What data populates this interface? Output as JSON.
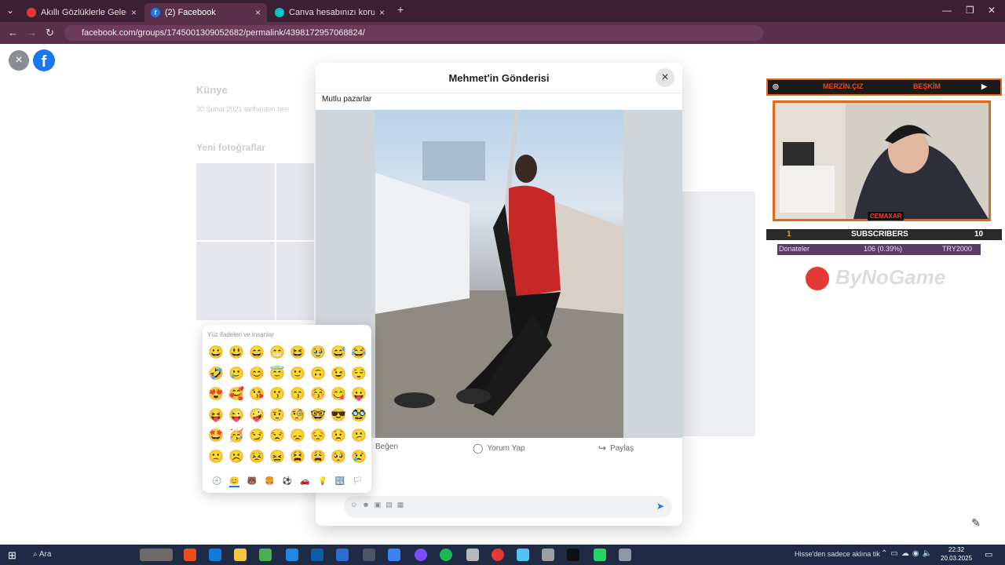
{
  "browser": {
    "tabs": [
      {
        "label": "Akıllı Gözlüklerle Geleceği",
        "favicon": "red-circle-icon",
        "color": "#e53935"
      },
      {
        "label": "(2) Facebook",
        "favicon": "facebook-icon",
        "color": "#1877f2"
      },
      {
        "label": "Canva hesabınızı koruyun",
        "favicon": "canva-icon",
        "color": "#00c4cc"
      }
    ],
    "new_tab": "+",
    "url": "facebook.com/groups/1745001309052682/permalink/4398172957068824/"
  },
  "page": {
    "close_button": "×",
    "logo": "f",
    "bg_heading": "Künye",
    "bg_info": "30 Şubat 2021 tarihinden beri",
    "bg_photos": "Yeni fotoğraflar"
  },
  "modal": {
    "title": "Mehmet'in Gönderisi",
    "close": "×",
    "post_text": "Mutlu pazarlar",
    "actions": {
      "like": "Beğen",
      "comment": "Yorum Yap",
      "share": "Paylaş"
    },
    "send_icon": "send-icon"
  },
  "emoji_picker": {
    "title": "Yüz ifadeleri ve insanlar",
    "emojis": [
      "😀",
      "😃",
      "😄",
      "😁",
      "😆",
      "🥹",
      "😅",
      "😂",
      "🤣",
      "🥲",
      "😊",
      "😇",
      "🙂",
      "🙃",
      "😉",
      "😌",
      "😍",
      "🥰",
      "😘",
      "😗",
      "😙",
      "😚",
      "😋",
      "😛",
      "😝",
      "😜",
      "🤪",
      "🤨",
      "🧐",
      "🤓",
      "😎",
      "🥸",
      "🤩",
      "🥳",
      "😏",
      "😒",
      "😞",
      "😔",
      "😟",
      "😕",
      "🙁",
      "☹️",
      "😣",
      "😖",
      "😫",
      "😩",
      "🥺",
      "😢"
    ],
    "tabs": [
      "🕘",
      "😊",
      "🐻",
      "🍔",
      "⚽",
      "🚗",
      "💡",
      "🔣",
      "🏳"
    ]
  },
  "overlay": {
    "top_left": "MERZİN.ÇIZ",
    "top_right": "BEŞKİM",
    "cam_badge": "CEMAXAR",
    "sub_count": "1",
    "sub_label": "SUBSCRIBERS",
    "sub_goal": "10",
    "don_label": "Donateler",
    "don_amount": "106 (0.39%)",
    "don_goal": "TRY2000",
    "logo_text": "ByNoGame"
  },
  "taskbar": {
    "search": "Ara",
    "news": "Hisse'den sadece aklına tik",
    "time": "22:32",
    "date": "20.03.2025"
  }
}
